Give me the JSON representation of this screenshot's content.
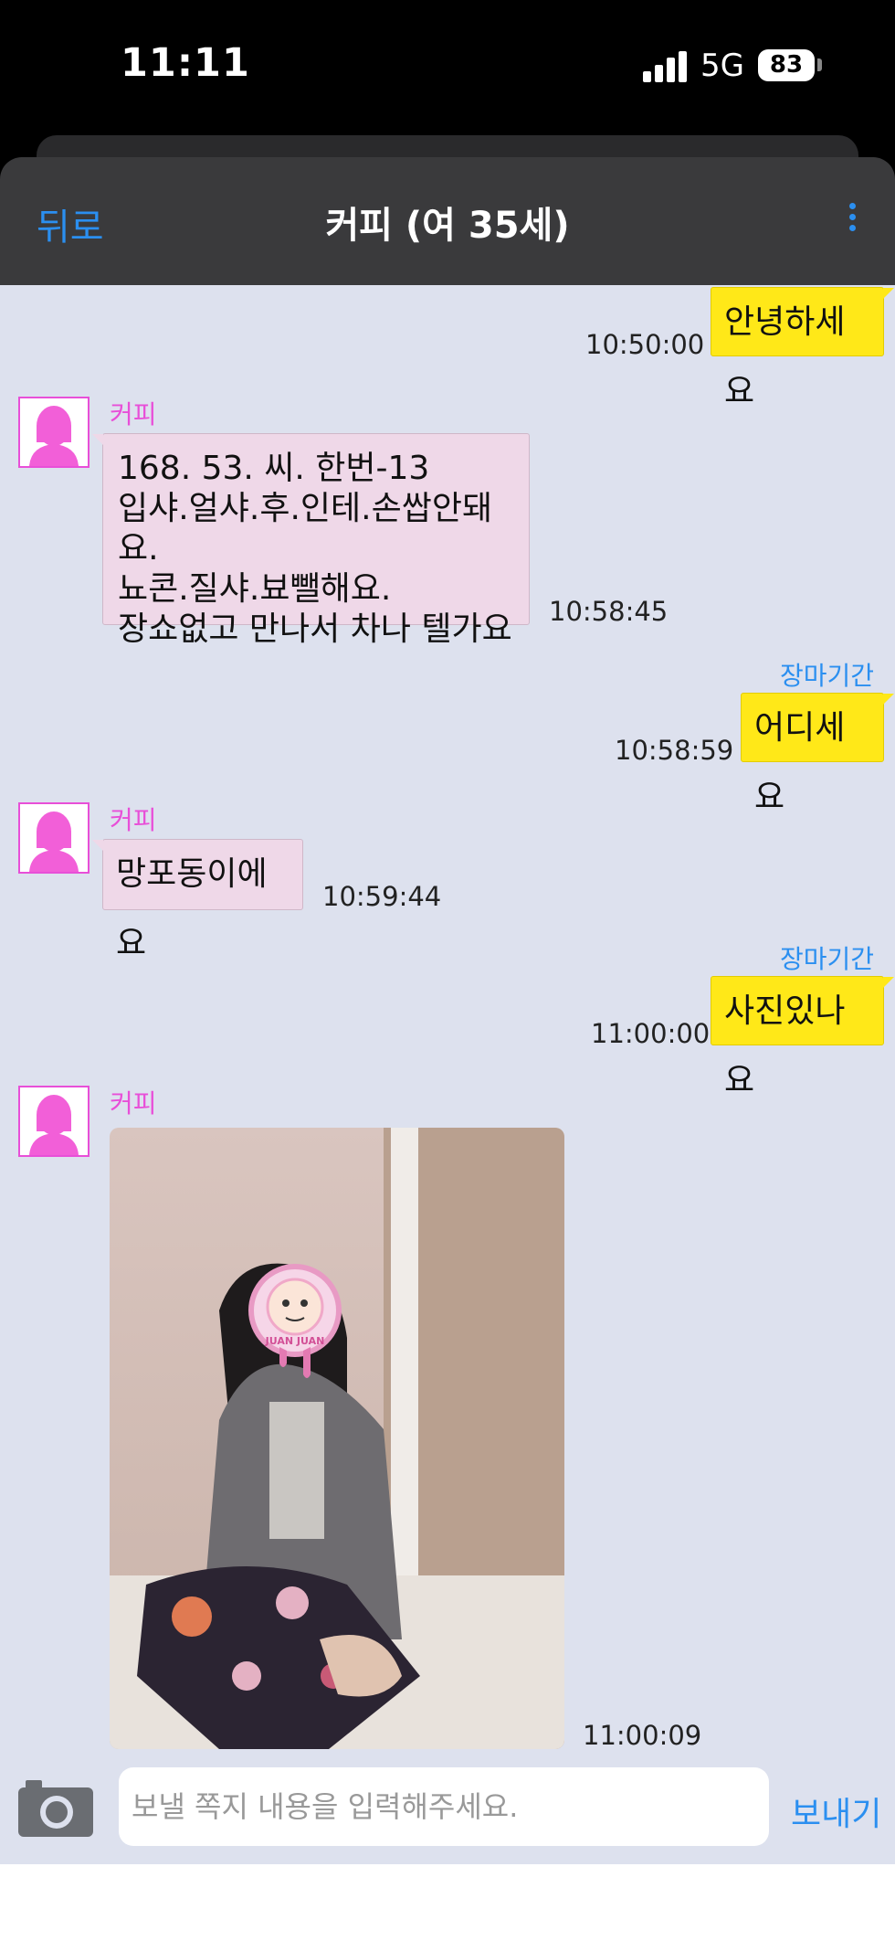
{
  "status_bar": {
    "time": "11:11",
    "network": "5G",
    "battery": "83"
  },
  "header": {
    "back_label": "뒤로",
    "title": "커피 (여 35세)"
  },
  "messages": [
    {
      "dir": "out",
      "text": "안녕하세요",
      "time": "10:50:00"
    },
    {
      "dir": "in",
      "sender": "커피",
      "lines": [
        "168. 53. 씨. 한번-13",
        "입샤.얼샤.후.인테.손쌉안돼요.",
        "뇨콘.질샤.뵤뺄해요.",
        "장쇼없고 만나서 차나 텔가요"
      ],
      "time": "10:58:45"
    },
    {
      "dir": "out",
      "sender": "장마기간",
      "text": "어디세요",
      "time": "10:58:59"
    },
    {
      "dir": "in",
      "sender": "커피",
      "text": "망포동이에요",
      "time": "10:59:44"
    },
    {
      "dir": "out",
      "sender": "장마기간",
      "text": "사진있나요",
      "time": "11:00:00"
    },
    {
      "dir": "in",
      "sender": "커피",
      "type": "photo",
      "time": "11:00:09",
      "sticker_text": "JUAN JUAN"
    }
  ],
  "input": {
    "placeholder": "보낼 쪽지 내용을 입력해주세요.",
    "send_label": "보내기"
  },
  "colors": {
    "accent": "#2b8ff0",
    "outgoing_bubble": "#ffe818",
    "incoming_bubble": "#efd8e8",
    "sender_pink": "#e84fd8",
    "chat_bg": "#dde1ee"
  }
}
